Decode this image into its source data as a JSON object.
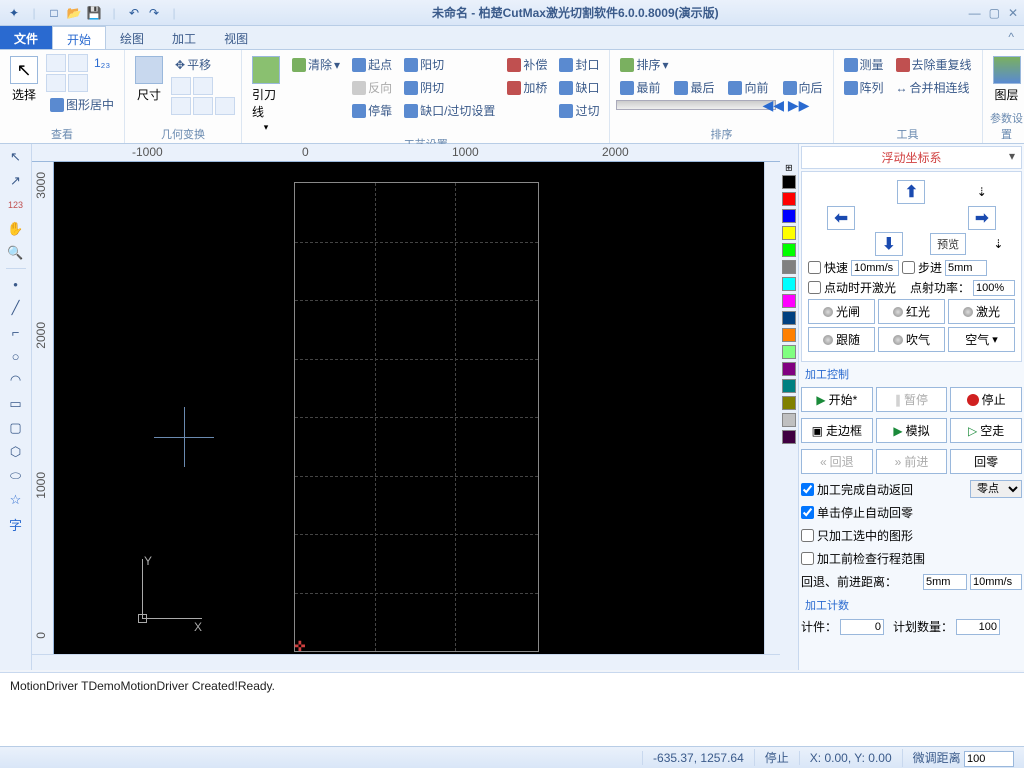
{
  "title": "未命名 - 柏楚CutMax激光切割软件6.0.0.8009(演示版)",
  "menu": {
    "file": "文件",
    "tabs": [
      "开始",
      "绘图",
      "加工",
      "视图"
    ]
  },
  "ribbon": {
    "view": {
      "select": "选择",
      "center": "图形居中",
      "label": "查看"
    },
    "geom": {
      "size": "尺寸",
      "translate": "平移",
      "label": "几何变换"
    },
    "proc": {
      "lead": "引刀线",
      "clear": "清除",
      "start": "起点",
      "reverse": "反向",
      "stop": "停靠",
      "yang": "阳切",
      "yin": "阴切",
      "quekou": "缺口/过切设置",
      "bu": "补偿",
      "jiaqiao": "加桥",
      "fengkou": "封口",
      "quekou2": "缺口",
      "guoqie": "过切",
      "label": "工艺设置"
    },
    "sort": {
      "sort": "排序",
      "front": "最前",
      "back": "最后",
      "fwd": "向前",
      "bwd": "向后",
      "label": "排序"
    },
    "tool": {
      "measure": "测量",
      "array": "阵列",
      "dedup": "去除重复线",
      "merge": "合并相连线",
      "label": "工具"
    },
    "layer": {
      "layer": "图层",
      "label": "参数设置"
    }
  },
  "ruler": {
    "h": [
      "-1000",
      "0",
      "1000",
      "2000"
    ],
    "v": [
      "3000",
      "2000",
      "1000",
      "0"
    ]
  },
  "axis": {
    "x": "X",
    "y": "Y"
  },
  "layers": [
    "#000000",
    "#ff0000",
    "#0000ff",
    "#ffff00",
    "#00ff00",
    "#808080",
    "#00ffff",
    "#ff00ff",
    "#004080",
    "#ff8000",
    "#80ff80",
    "#800080",
    "#008080",
    "#808000",
    "#c0c0c0",
    "#400040"
  ],
  "rp": {
    "coord": "浮动坐标系",
    "preview": "预览",
    "fast": "快速",
    "step": "步进",
    "fastval": "10mm/s",
    "stepval": "5mm",
    "laseron": "点动时开激光",
    "power": "点射功率：",
    "powerval": "100%",
    "btns1": [
      "光闸",
      "红光",
      "激光"
    ],
    "btns2": [
      "跟随",
      "吹气"
    ],
    "air": "空气",
    "ctrl": "加工控制",
    "start": "开始*",
    "pause": "暂停",
    "stop": "停止",
    "frame": "走边框",
    "sim": "模拟",
    "dry": "空走",
    "back": "回退",
    "fwd": "前进",
    "home": "回零",
    "chk1": "加工完成自动返回",
    "chk2": "单击停止自动回零",
    "chk3": "只加工选中的图形",
    "chk4": "加工前检查行程范围",
    "origin": "零点",
    "dist": "回退、前进距离：",
    "d1": "5mm",
    "d2": "10mm/s",
    "count": "加工计数",
    "cnt": "计件：",
    "cntval": "0",
    "plan": "计划数量：",
    "planval": "100"
  },
  "log": "MotionDriver TDemoMotionDriver Created!Ready.",
  "status": {
    "coord": "-635.37, 1257.64",
    "state": "停止",
    "pos": "X: 0.00, Y: 0.00",
    "jog": "微调距离",
    "jogval": "100"
  }
}
